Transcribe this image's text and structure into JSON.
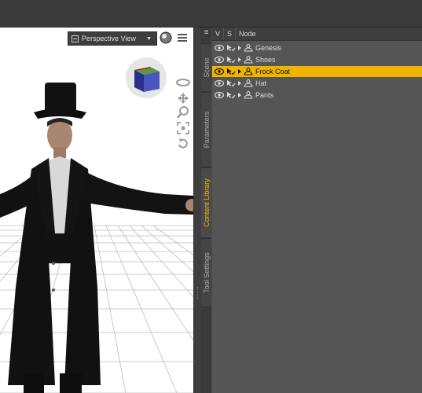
{
  "viewport": {
    "camera_label": "Perspective View",
    "icons": [
      "camera-view-icon",
      "sphere-icon",
      "panel-menu-icon",
      "nav-cube-icon",
      "orbit-icon",
      "pan-icon",
      "zoom-icon",
      "frame-icon",
      "reset-icon"
    ]
  },
  "tabs": [
    {
      "label": "Scene",
      "active": false
    },
    {
      "label": "Parameters",
      "active": false
    },
    {
      "label": "Content Library",
      "active": true
    },
    {
      "label": "Tool Settings",
      "active": false
    }
  ],
  "scene": {
    "headers": {
      "visible": "V",
      "selectable": "S",
      "node": "Node"
    },
    "nodes": [
      {
        "name": "Genesis",
        "selected": false
      },
      {
        "name": "Shoes",
        "selected": false
      },
      {
        "name": "Frock Coat",
        "selected": true
      },
      {
        "name": "Hat",
        "selected": false
      },
      {
        "name": "Pants",
        "selected": false
      }
    ]
  },
  "colors": {
    "accent": "#f0b400",
    "panel": "#555555",
    "viewport": "#ffffff"
  }
}
